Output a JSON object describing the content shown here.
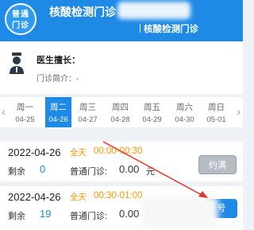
{
  "header": {
    "badge_line1": "普通",
    "badge_line2": "门诊",
    "title": "核酸检测门诊",
    "subtitle": "核酸检测门诊"
  },
  "doctor": {
    "specialty_label": "医生擅长：",
    "intro_label": "门诊简介：-"
  },
  "week": {
    "days": [
      {
        "weekday": "周一",
        "date": "04-25"
      },
      {
        "weekday": "周二",
        "date": "04-26"
      },
      {
        "weekday": "周三",
        "date": "04-27"
      },
      {
        "weekday": "周四",
        "date": "04-28"
      },
      {
        "weekday": "周五",
        "date": "04-29"
      },
      {
        "weekday": "周六",
        "date": "04-30"
      },
      {
        "weekday": "周日",
        "date": "05-01"
      }
    ],
    "prev_arrow": "‹",
    "next_arrow": "›"
  },
  "slots": [
    {
      "date": "2022-04-26",
      "period": "全天",
      "time": "00:00-00:30",
      "remaining_label": "剩余",
      "remaining": "0",
      "type": "普通门诊:",
      "price": "0.00",
      "unit": "元",
      "button": "约满"
    },
    {
      "date": "2022-04-26",
      "period": "全天",
      "time": "00:30-01:00",
      "remaining_label": "剩余",
      "remaining": "19",
      "type": "普通门诊:",
      "price": "0.00",
      "unit": "元",
      "button": "号"
    }
  ],
  "colors": {
    "brand": "#1e8ae6",
    "accent_orange": "#ff9500",
    "annotation_red": "#e0312b"
  }
}
